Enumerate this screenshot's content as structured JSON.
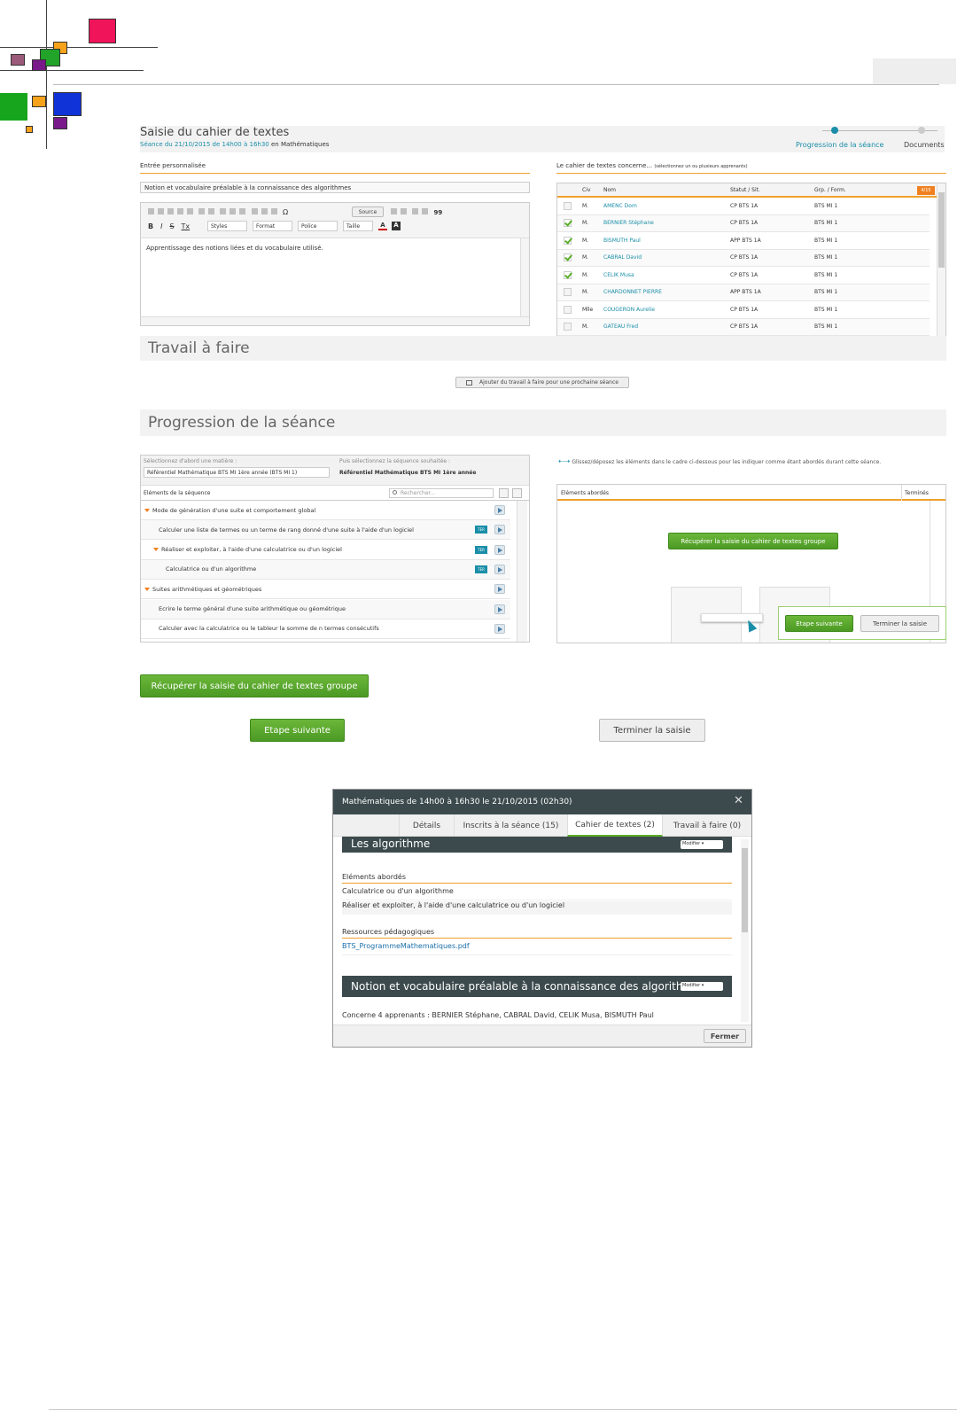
{
  "page": {
    "title": "Saisie du cahier de textes",
    "subtitle_link": "Séance du 21/10/2015 de 14h00 à 16h30",
    "subtitle_rest": " en Mathématiques"
  },
  "stepper": {
    "step1": "Progression de la séance",
    "step2": "Documents"
  },
  "entry": {
    "heading": "Entrée personnalisée",
    "title_value": "Notion et vocabulaire préalable à la connaissance des algorithmes",
    "toolbar": {
      "source": "Source",
      "styles": "Styles",
      "format": "Format",
      "police": "Police",
      "taille": "Taille",
      "bold": "B",
      "italic": "I",
      "strike": "S",
      "clear": "Tx",
      "quote": "99",
      "omega": "Ω"
    },
    "editor_text": "Apprentissage des notions liées et du vocabulaire utilisé."
  },
  "concerned": {
    "heading": "Le cahier de textes concerne...",
    "hint": "(sélectionnez un ou plusieurs apprenants)",
    "columns": {
      "civ": "Civ",
      "name": "Nom",
      "status": "Statut / Sit.",
      "group": "Grp. / Form."
    },
    "count": "4/15",
    "rows": [
      {
        "civ": "M.",
        "name": "AMENC Dom",
        "status": "CP BTS 1A",
        "group": "BTS MI 1",
        "checked": false
      },
      {
        "civ": "M.",
        "name": "BERNIER Stéphane",
        "status": "CP BTS 1A",
        "group": "BTS MI 1",
        "checked": true
      },
      {
        "civ": "M.",
        "name": "BISMUTH Paul",
        "status": "APP BTS 1A",
        "group": "BTS MI 1",
        "checked": true
      },
      {
        "civ": "M.",
        "name": "CABRAL David",
        "status": "CP BTS 1A",
        "group": "BTS MI 1",
        "checked": true
      },
      {
        "civ": "M.",
        "name": "CELIK Musa",
        "status": "CP BTS 1A",
        "group": "BTS MI 1",
        "checked": true
      },
      {
        "civ": "M.",
        "name": "CHARDONNET PIERRE",
        "status": "APP BTS 1A",
        "group": "BTS MI 1",
        "checked": false
      },
      {
        "civ": "Mlle",
        "name": "COUGERON Aurelie",
        "status": "CP BTS 1A",
        "group": "BTS MI 1",
        "checked": false
      },
      {
        "civ": "M.",
        "name": "GATEAU Fred",
        "status": "CP BTS 1A",
        "group": "BTS MI 1",
        "checked": false
      }
    ]
  },
  "travail": {
    "section_title": "Travail à faire",
    "add_button": "Ajouter du travail à faire pour une prochaine séance"
  },
  "progression": {
    "section_title": "Progression de la séance",
    "select_label": "Sélectionnez d'abord une matière :",
    "select_value": "Référentiel Mathématique BTS MI 1ère année (BTS MI 1)",
    "seq_label": "Puis sélectionnez la séquence souhaitée :",
    "seq_value": "Référentiel Mathématique BTS MI 1ère année",
    "elements_header": "Eléments de la séquence",
    "search_placeholder": "Rechercher...",
    "ter_badge": "TER",
    "items": [
      {
        "label": "Mode de génération d'une suite et comportement global",
        "level": 0,
        "ter": false,
        "caret": true
      },
      {
        "label": "Calculer une liste de termes ou un terme de rang donné d'une suite à l'aide d'un logiciel",
        "level": 1,
        "ter": true,
        "caret": false
      },
      {
        "label": "Réaliser et exploiter, à l'aide d'une calculatrice ou d'un logiciel",
        "level": 1,
        "ter": true,
        "caret": true
      },
      {
        "label": "Calculatrice ou d'un algorithme",
        "level": 2,
        "ter": true,
        "caret": false
      },
      {
        "label": "Suites arithmétiques et géométriques",
        "level": 0,
        "ter": false,
        "caret": true
      },
      {
        "label": "Ecrire le terme général d'une suite arithmétique ou géométrique",
        "level": 1,
        "ter": false,
        "caret": false
      },
      {
        "label": "Calculer avec la calculatrice ou le tableur la somme de n termes consécutifs",
        "level": 1,
        "ter": false,
        "caret": false
      }
    ],
    "drag_hint": "Glissez/déposez les éléments dans le cadre ci-dessous pour les indiquer comme étant abordés durant cette séance.",
    "abordes_header": "Eléments abordés",
    "termines_header": "Terminés",
    "recup_button": "Récupérer la saisie du cahier de textes groupe",
    "next_button": "Etape suivante",
    "finish_button": "Terminer la saisie"
  },
  "zoom": {
    "recup_button": "Récupérer la saisie du cahier de textes groupe",
    "next_button": "Etape suivante",
    "finish_button": "Terminer la saisie"
  },
  "modal": {
    "title": "Mathématiques de 14h00 à 16h30 le 21/10/2015 (02h30)",
    "close": "✕",
    "tabs": [
      "Détails",
      "Inscrits à la séance (15)",
      "Cahier de textes (2)",
      "Travail à faire (0)"
    ],
    "entry1_title": "Les algorithme",
    "modify": "Modifier",
    "elements_heading": "Eléments abordés",
    "elements": [
      "Calculatrice ou d'un algorithme",
      "Réaliser et exploiter, à l'aide d'une calculatrice ou d'un logiciel"
    ],
    "resources_heading": "Ressources pédagogiques",
    "resource_link": "BTS_ProgrammeMathematiques.pdf",
    "entry2_title": "Notion et vocabulaire préalable à la connaissance des algorithmes",
    "concerne": "Concerne 4 apprenants : BERNIER Stéphane, CABRAL David, CELIK Musa, BISMUTH Paul",
    "close_button": "Fermer"
  }
}
